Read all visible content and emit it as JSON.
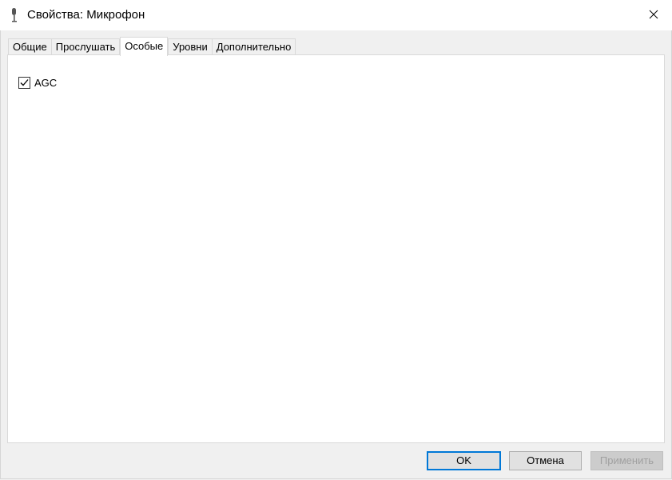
{
  "window": {
    "title": "Свойства: Микрофон"
  },
  "tabs": [
    {
      "label": "Общие",
      "active": false
    },
    {
      "label": "Прослушать",
      "active": false
    },
    {
      "label": "Особые",
      "active": true
    },
    {
      "label": "Уровни",
      "active": false
    },
    {
      "label": "Дополнительно",
      "active": false
    }
  ],
  "panel": {
    "agc": {
      "label": "AGC",
      "checked": true
    }
  },
  "buttons": {
    "ok": "OK",
    "cancel": "Отмена",
    "apply": "Применить"
  },
  "icons": {
    "window": "microphone-icon",
    "close": "close-icon",
    "check": "checkmark-icon"
  },
  "colors": {
    "accent": "#0078d7",
    "titlebar": "#ffffff",
    "dialog_bg": "#f0f0f0",
    "disabled_text": "#a0a0a0"
  }
}
